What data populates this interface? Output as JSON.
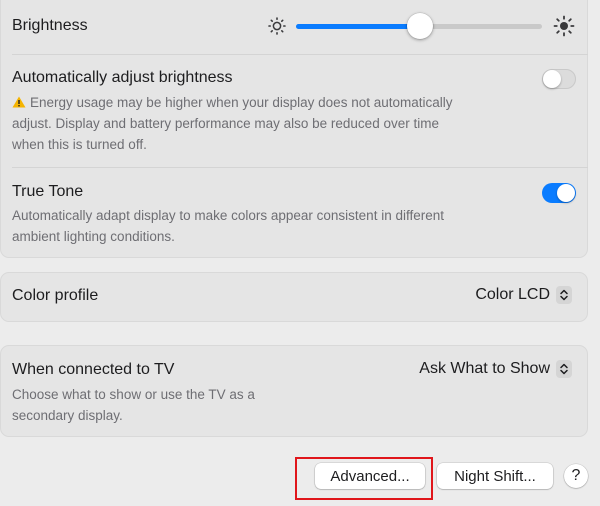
{
  "display": {
    "brightness": {
      "label": "Brightness",
      "level": 0.5
    },
    "auto_brightness": {
      "label": "Automatically adjust brightness",
      "warning": "Energy usage may be higher when your display does not automatically adjust. Display and battery performance may also be reduced over time when this is turned off.",
      "warning_lines": [
        "Energy usage may be higher when your display does not automatically",
        "adjust. Display and battery performance may also be reduced over time",
        "when this is turned off."
      ],
      "enabled": false
    },
    "true_tone": {
      "label": "True Tone",
      "description_lines": [
        "Automatically adapt display to make colors appear consistent in different",
        "ambient lighting conditions."
      ],
      "enabled": true
    },
    "color_profile": {
      "label": "Color profile",
      "value": "Color LCD"
    },
    "tv": {
      "label": "When connected to TV",
      "value": "Ask What to Show",
      "description_lines": [
        "Choose what to show or use the TV as a",
        "secondary display."
      ]
    }
  },
  "footer": {
    "advanced_label": "Advanced...",
    "night_shift_label": "Night Shift...",
    "help_label": "?"
  },
  "colors": {
    "accent": "#0a7cff",
    "warning": "#f5b400",
    "highlight": "#e0161b"
  },
  "icons": {
    "brightness_low": "sun-small-icon",
    "brightness_high": "sun-large-icon",
    "warning": "warning-triangle-icon",
    "popup": "chevron-updown-icon"
  }
}
